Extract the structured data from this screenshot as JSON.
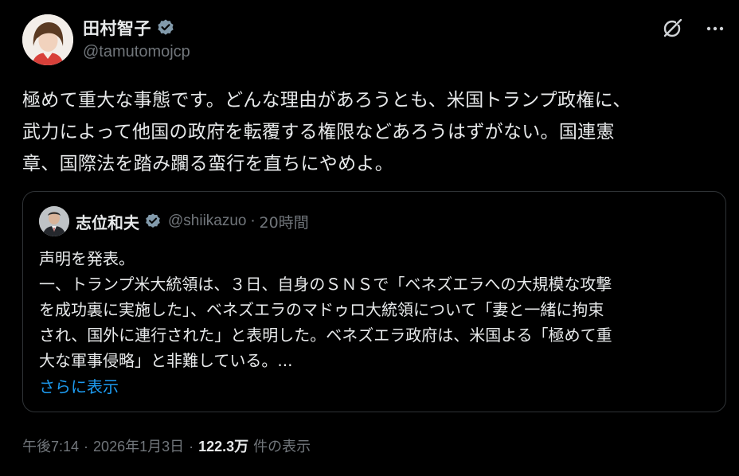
{
  "author": {
    "display_name": "田村智子",
    "handle": "@tamutomojcp"
  },
  "post": {
    "text": "極めて重大な事態です。どんな理由があろうとも、米国トランプ政権に、\n武力によって他国の政府を転覆する権限などあろうはずがない。国連憲\n章、国際法を踏み躙る蛮行を直ちにやめよ。"
  },
  "quoted": {
    "display_name": "志位和夫",
    "handle": "@shiikazuo",
    "separator": "·",
    "time": "20時間",
    "text": "声明を発表。\n一、トランプ米大統領は、３日、自身のＳＮＳで「ベネズエラへの大規模な攻撃\nを成功裏に実施した」、ベネズエラのマドゥロ大統領について「妻と一緒に拘束\nされ、国外に連行された」と表明した。ベネズエラ政府は、米国よる「極めて重\n大な軍事侵略」と非難している。...",
    "show_more": "さらに表示"
  },
  "footer": {
    "time": "午後7:14",
    "dot1": "·",
    "date": "2026年1月3日",
    "dot2": "·",
    "views_count": "122.3万",
    "views_label": "件の表示"
  },
  "icons": {
    "verified": "verified-badge-icon",
    "grok": "grok-icon",
    "more": "more-icon"
  },
  "colors": {
    "background": "#000000",
    "text": "#e7e9ea",
    "muted": "#71767b",
    "link": "#1d9bf0",
    "border": "#2f3336",
    "verified_badge": "#829aab"
  }
}
